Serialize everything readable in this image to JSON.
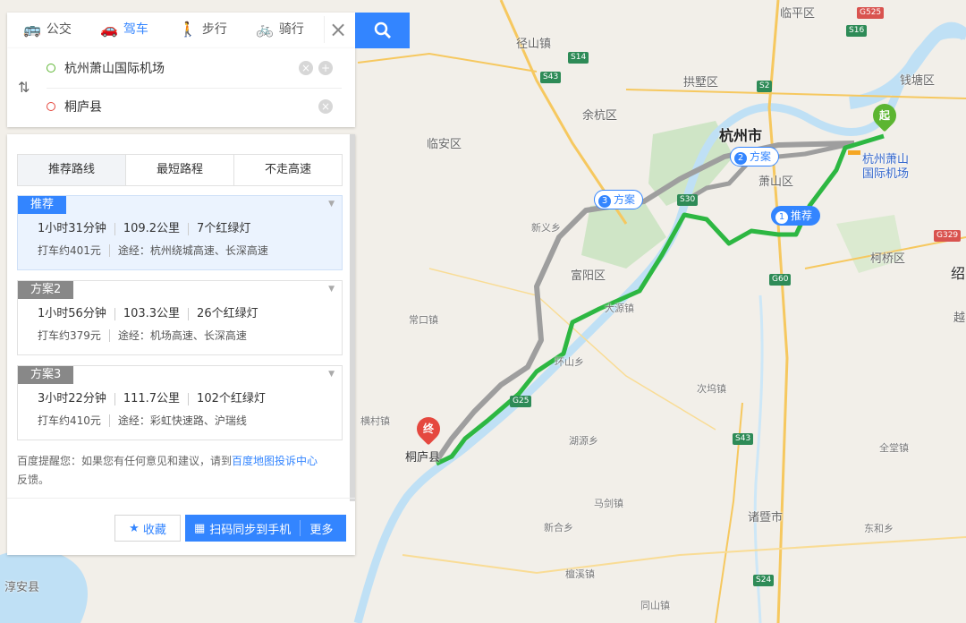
{
  "modes": [
    {
      "label": "公交",
      "icon": "bus-icon"
    },
    {
      "label": "驾车",
      "icon": "car-icon"
    },
    {
      "label": "步行",
      "icon": "walk-icon"
    },
    {
      "label": "骑行",
      "icon": "bike-icon"
    }
  ],
  "active_mode": "驾车",
  "search": {
    "start": "杭州萧山国际机场",
    "end": "桐庐县"
  },
  "route_prefs": [
    "推荐路线",
    "最短路程",
    "不走高速"
  ],
  "routes": [
    {
      "tag": "推荐",
      "time": "1小时31分钟",
      "distance": "109.2公里",
      "lights": "7个红绿灯",
      "taxi": "打车约401元",
      "via": "途经：杭州绕城高速、长深高速"
    },
    {
      "tag": "方案2",
      "time": "1小时56分钟",
      "distance": "103.3公里",
      "lights": "26个红绿灯",
      "taxi": "打车约379元",
      "via": "途经：机场高速、长深高速"
    },
    {
      "tag": "方案3",
      "time": "3小时22分钟",
      "distance": "111.7公里",
      "lights": "102个红绿灯",
      "taxi": "打车约410元",
      "via": "途经：彩虹快速路、沪瑞线"
    }
  ],
  "tip": {
    "text": "百度提醒您：如果您有任何意见和建议，请到",
    "link": "百度地图投诉中心",
    "tail": "反馈。"
  },
  "actions": {
    "favorite": "收藏",
    "sync": "扫码同步到手机",
    "more": "更多"
  },
  "map": {
    "callouts": [
      {
        "num": "1",
        "label": "推荐"
      },
      {
        "num": "2",
        "label": "方案"
      },
      {
        "num": "3",
        "label": "方案"
      }
    ],
    "start_marker": "起",
    "end_marker": "终",
    "labels": {
      "linping": "临平区",
      "jingshan": "径山镇",
      "gongshu": "拱墅区",
      "qiantang": "钱塘区",
      "yuhang": "余杭区",
      "hangzhou": "杭州市",
      "linan": "临安区",
      "xiaoshan": "萧山区",
      "airport1": "杭州萧山",
      "airport2": "国际机场",
      "xinyi": "新义乡",
      "fuyang": "富阳区",
      "keqiao": "柯桥区",
      "shao": "绍",
      "yue": "越",
      "dayuan": "大源镇",
      "changkou": "常口镇",
      "huanshan": "环山乡",
      "cixia": "次坞镇",
      "hengcun": "横村镇",
      "tonglu": "桐庐县",
      "quantang": "全堂镇",
      "huyuan": "湖源乡",
      "majian": "马剑镇",
      "xinhe": "新合乡",
      "zhuji": "诸暨市",
      "donghe": "东和乡",
      "chunan": "淳安县",
      "tanxi": "檀溪镇",
      "tongshan": "同山镇"
    },
    "shields": [
      "S14",
      "S43",
      "S2",
      "G525",
      "S16",
      "S30",
      "G60",
      "G25",
      "S43",
      "S24",
      "G329"
    ]
  }
}
